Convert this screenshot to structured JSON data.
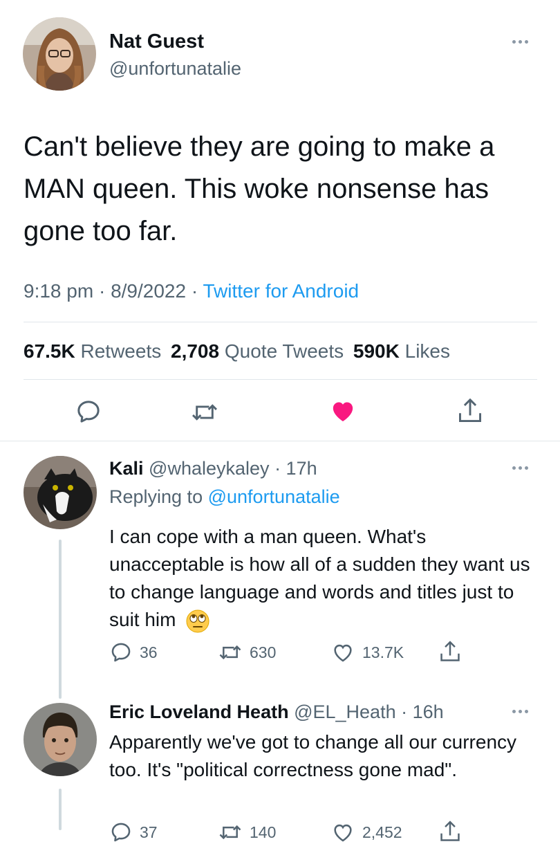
{
  "main_tweet": {
    "display_name": "Nat Guest",
    "handle": "@unfortunatalie",
    "text": "Can't believe they are going to make a MAN queen. This woke nonsense has gone too far.",
    "time": "9:18 pm",
    "sep1": "·",
    "date": "8/9/2022",
    "sep2": "·",
    "source": "Twitter for Android",
    "stats": {
      "retweets_count": "67.5K",
      "retweets_label": "Retweets",
      "quotes_count": "2,708",
      "quotes_label": "Quote Tweets",
      "likes_count": "590K",
      "likes_label": "Likes"
    },
    "icons": {
      "reply": "reply-icon",
      "retweet": "retweet-icon",
      "like": "heart-filled-icon",
      "share": "share-icon"
    },
    "like_color": "#f91880"
  },
  "replies": [
    {
      "display_name": "Kali",
      "handle": "@whaleykaley",
      "time": "· 17h",
      "replying_prefix": "Replying to",
      "replying_handle": "@unfortunatalie",
      "text": "I can cope with a man queen. What's unacceptable is how all of a sudden they want us to change language and words and titles just to suit him",
      "emoji": "face-with-rolling-eyes",
      "reply_count": "36",
      "retweet_count": "630",
      "like_count": "13.7K"
    },
    {
      "display_name": "Eric Loveland Heath",
      "handle": "@EL_Heath",
      "time": "· 16h",
      "text": "Apparently we've got to change all our currency too. It's \"political correctness gone mad\".",
      "reply_count": "37",
      "retweet_count": "140",
      "like_count": "2,452"
    }
  ],
  "colors": {
    "text": "#0f1419",
    "secondary": "#536471",
    "link": "#1d9bf0",
    "like": "#f91880",
    "divider": "#e1e6ea"
  }
}
